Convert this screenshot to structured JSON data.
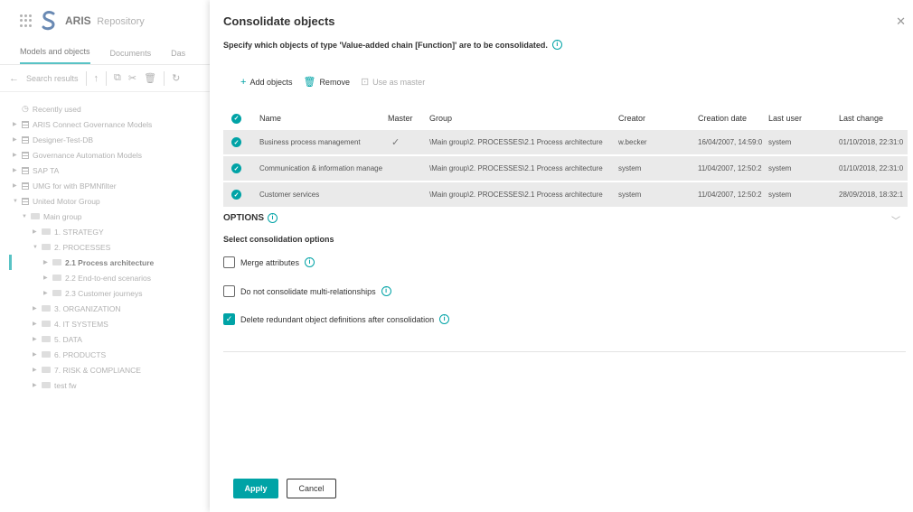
{
  "app": {
    "title": "ARIS",
    "subtitle": "Repository",
    "tabs": [
      "Models and objects",
      "Documents",
      "Das"
    ],
    "toolbar": {
      "search_results": "Search results"
    },
    "tree": [
      {
        "label": "Recently used",
        "icon": "clock-icon",
        "indent": 0
      },
      {
        "label": "ARIS Connect Governance Models",
        "icon": "database-icon",
        "indent": 0
      },
      {
        "label": "Designer-Test-DB",
        "icon": "database-icon",
        "indent": 0
      },
      {
        "label": "Governance Automation Models",
        "icon": "database-icon",
        "indent": 0
      },
      {
        "label": "SAP TA",
        "icon": "database-icon",
        "indent": 0
      },
      {
        "label": "UMG for with BPMNfilter",
        "icon": "database-icon",
        "indent": 0
      },
      {
        "label": "United Motor Group",
        "icon": "database-icon",
        "indent": 0
      },
      {
        "label": "Main group",
        "icon": "folder-icon",
        "indent": 1
      },
      {
        "label": "1. STRATEGY",
        "icon": "folder-icon",
        "indent": 2
      },
      {
        "label": "2. PROCESSES",
        "icon": "folder-icon",
        "indent": 2
      },
      {
        "label": "2.1 Process architecture",
        "icon": "folder-icon",
        "indent": 3
      },
      {
        "label": "2.2 End-to-end scenarios",
        "icon": "folder-icon",
        "indent": 3
      },
      {
        "label": "2.3 Customer journeys",
        "icon": "folder-icon",
        "indent": 3
      },
      {
        "label": "3. ORGANIZATION",
        "icon": "folder-icon",
        "indent": 2
      },
      {
        "label": "4. IT SYSTEMS",
        "icon": "folder-icon",
        "indent": 2
      },
      {
        "label": "5. DATA",
        "icon": "folder-icon",
        "indent": 2
      },
      {
        "label": "6. PRODUCTS",
        "icon": "folder-icon",
        "indent": 2
      },
      {
        "label": "7. RISK & COMPLIANCE",
        "icon": "folder-icon",
        "indent": 2
      },
      {
        "label": "test fw",
        "icon": "folder-icon",
        "indent": 2
      }
    ]
  },
  "dialog": {
    "title": "Consolidate objects",
    "description": "Specify which objects of type 'Value-added chain [Function]' are to be consolidated.",
    "actions": {
      "add": "Add objects",
      "remove": "Remove",
      "use_as_master": "Use as master"
    },
    "columns": {
      "name": "Name",
      "master": "Master",
      "group": "Group",
      "creator": "Creator",
      "creation_date": "Creation date",
      "last_user": "Last user",
      "last_change": "Last change"
    },
    "rows": [
      {
        "name": "Business process management",
        "master": "✓",
        "group": "\\Main group\\2. PROCESSES\\2.1 Process architecture",
        "creator": "w.becker",
        "creation_date": "16/04/2007, 14:59:0",
        "last_user": "system",
        "last_change": "01/10/2018, 22:31:0"
      },
      {
        "name": "Communication & information manage",
        "master": "",
        "group": "\\Main group\\2. PROCESSES\\2.1 Process architecture",
        "creator": "system",
        "creation_date": "11/04/2007, 12:50:2",
        "last_user": "system",
        "last_change": "01/10/2018, 22:31:0"
      },
      {
        "name": "Customer services",
        "master": "",
        "group": "\\Main group\\2. PROCESSES\\2.1 Process architecture",
        "creator": "system",
        "creation_date": "11/04/2007, 12:50:2",
        "last_user": "system",
        "last_change": "28/09/2018, 18:32:1"
      }
    ],
    "options": {
      "heading": "OPTIONS",
      "subheading": "Select consolidation options",
      "merge_attributes": {
        "label": "Merge attributes",
        "checked": false
      },
      "no_multi_relationships": {
        "label": "Do not consolidate multi-relationships",
        "checked": false
      },
      "delete_redundant": {
        "label": "Delete redundant object definitions after consolidation",
        "checked": true
      }
    },
    "buttons": {
      "apply": "Apply",
      "cancel": "Cancel"
    }
  },
  "colors": {
    "accent": "#00a3a6"
  }
}
